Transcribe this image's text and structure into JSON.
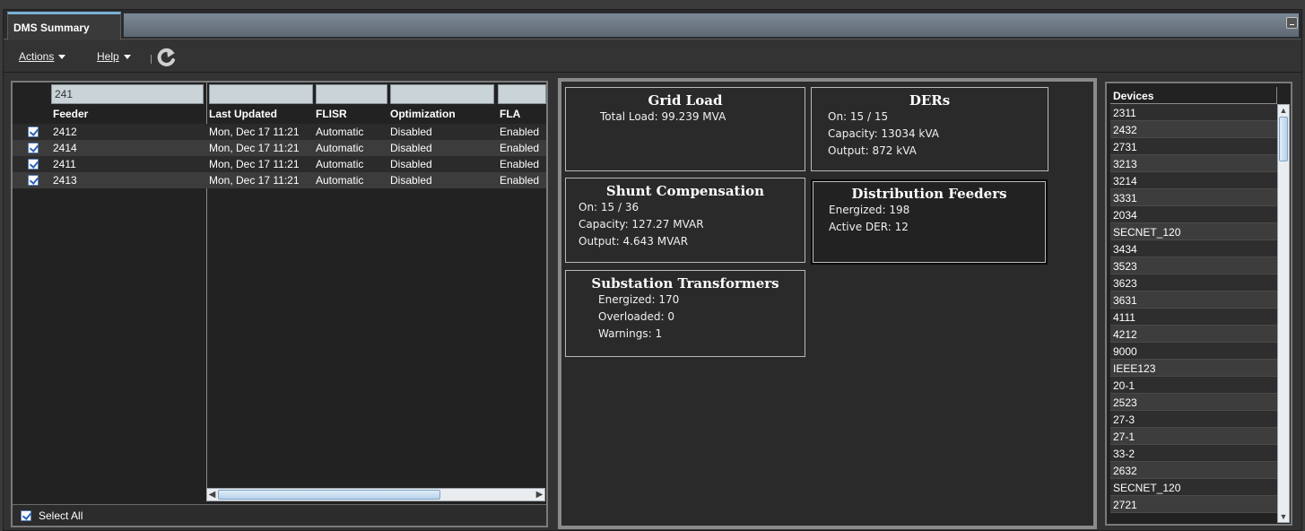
{
  "tab": {
    "title": "DMS Summary"
  },
  "menu": {
    "actions": "Actions",
    "help": "Help"
  },
  "feeders": {
    "filters": [
      "241",
      "",
      "",
      "",
      ""
    ],
    "columns": [
      "Feeder",
      "Last Updated",
      "FLISR",
      "Optimization",
      "FLA"
    ],
    "rows": [
      {
        "checked": true,
        "feeder": "2412",
        "updated": "Mon, Dec 17 11:21",
        "flisr": "Automatic",
        "opt": "Disabled",
        "fla": "Enabled"
      },
      {
        "checked": true,
        "feeder": "2414",
        "updated": "Mon, Dec 17 11:21",
        "flisr": "Automatic",
        "opt": "Disabled",
        "fla": "Enabled"
      },
      {
        "checked": true,
        "feeder": "2411",
        "updated": "Mon, Dec 17 11:21",
        "flisr": "Automatic",
        "opt": "Disabled",
        "fla": "Enabled"
      },
      {
        "checked": true,
        "feeder": "2413",
        "updated": "Mon, Dec 17 11:21",
        "flisr": "Automatic",
        "opt": "Disabled",
        "fla": "Enabled"
      }
    ],
    "select_all": "Select All",
    "select_all_checked": true
  },
  "summary": {
    "grid_load": {
      "title": "Grid Load",
      "lines": [
        "Total Load: 99.239 MVA"
      ]
    },
    "ders": {
      "title": "DERs",
      "lines": [
        "On: 15 / 15",
        "Capacity: 13034 kVA",
        "Output: 872 kVA"
      ]
    },
    "shunt": {
      "title": "Shunt Compensation",
      "lines": [
        "On: 15 / 36",
        "Capacity: 127.27 MVAR",
        "Output: 4.643 MVAR"
      ]
    },
    "dist_feeders": {
      "title": "Distribution Feeders",
      "lines": [
        "Energized: 198",
        "Active DER: 12"
      ]
    },
    "substation": {
      "title": "Substation Transformers",
      "lines": [
        "Energized: 170",
        "Overloaded: 0",
        "Warnings: 1"
      ]
    }
  },
  "devices": {
    "header": "Devices",
    "items": [
      "2311",
      "2432",
      "2731",
      "3213",
      "3214",
      "3331",
      "2034",
      "SECNET_120",
      "3434",
      "3523",
      "3623",
      "3631",
      "4111",
      "4212",
      "9000",
      "IEEE123",
      "20-1",
      "2523",
      "27-3",
      "27-1",
      "33-2",
      "2632",
      "SECNET_120",
      "2721"
    ]
  },
  "colors": {
    "tab_accent": "#7ab0d6",
    "check_blue": "#2a62b8",
    "filter_bg": "#c9d3d8"
  },
  "icons": {
    "refresh": "refresh-icon",
    "minimize": "minimize-icon"
  }
}
